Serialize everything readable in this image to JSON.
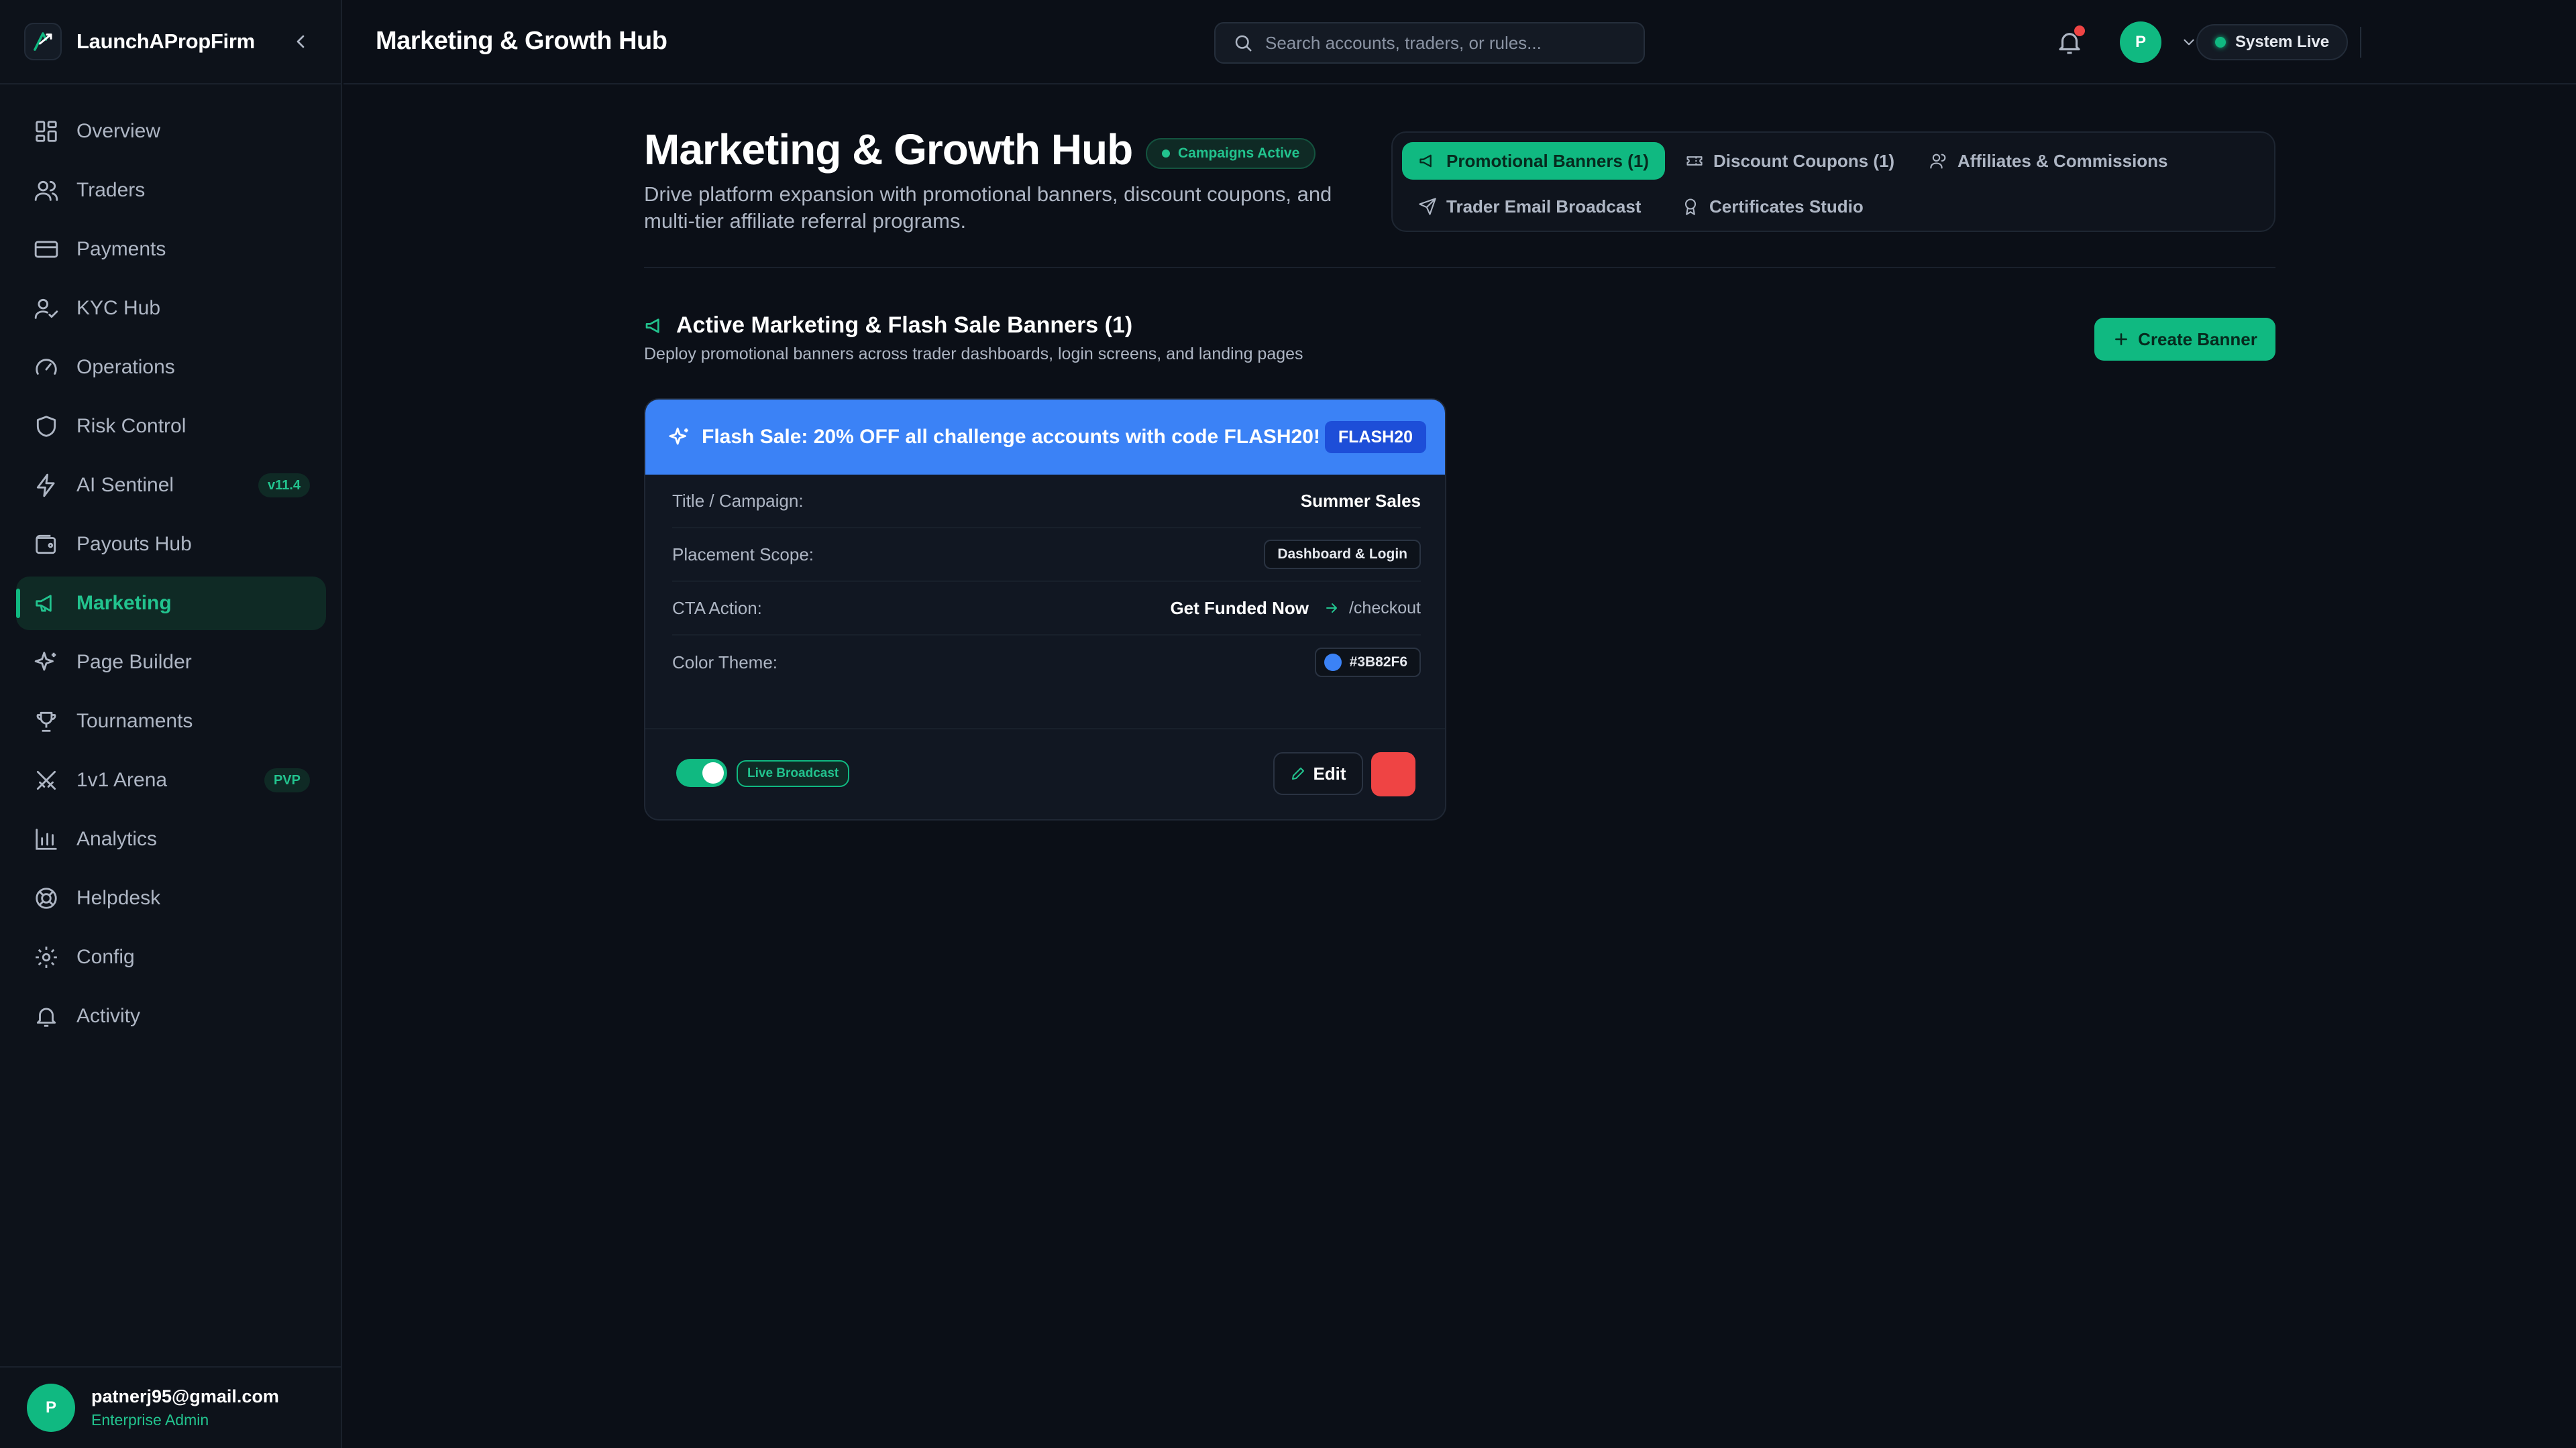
{
  "brand": {
    "name": "LaunchAPropFirm"
  },
  "sidebar": {
    "items": [
      {
        "label": "Overview",
        "icon": "grid-icon"
      },
      {
        "label": "Traders",
        "icon": "users-icon"
      },
      {
        "label": "Payments",
        "icon": "credit-card-icon"
      },
      {
        "label": "KYC Hub",
        "icon": "user-check-icon"
      },
      {
        "label": "Operations",
        "icon": "gauge-icon"
      },
      {
        "label": "Risk Control",
        "icon": "shield-icon"
      },
      {
        "label": "AI Sentinel",
        "icon": "bolt-icon",
        "badge": "v11.4"
      },
      {
        "label": "Payouts Hub",
        "icon": "wallet-icon"
      },
      {
        "label": "Marketing",
        "icon": "megaphone-icon",
        "active": true
      },
      {
        "label": "Page Builder",
        "icon": "sparkles-icon"
      },
      {
        "label": "Tournaments",
        "icon": "trophy-icon"
      },
      {
        "label": "1v1 Arena",
        "icon": "swords-icon",
        "badge": "PVP"
      },
      {
        "label": "Analytics",
        "icon": "bar-chart-icon"
      },
      {
        "label": "Helpdesk",
        "icon": "lifebuoy-icon"
      },
      {
        "label": "Config",
        "icon": "gear-icon"
      },
      {
        "label": "Activity",
        "icon": "bell-icon"
      }
    ]
  },
  "user": {
    "initial": "P",
    "email": "patnerj95@gmail.com",
    "role": "Enterprise Admin"
  },
  "topbar": {
    "title": "Marketing & Growth Hub",
    "search_placeholder": "Search accounts, traders, or rules...",
    "status": "System Live",
    "avatar_initial": "P"
  },
  "header": {
    "title": "Marketing & Growth Hub",
    "status_pill": "Campaigns Active",
    "subtitle": "Drive platform expansion with promotional banners, discount coupons, and multi-tier affiliate referral programs."
  },
  "tabs": [
    {
      "label": "Promotional Banners (1)",
      "icon": "megaphone-icon",
      "active": true
    },
    {
      "label": "Discount Coupons (1)",
      "icon": "ticket-icon"
    },
    {
      "label": "Affiliates & Commissions",
      "icon": "users-icon"
    },
    {
      "label": "Trader Email Broadcast",
      "icon": "send-icon"
    },
    {
      "label": "Certificates Studio",
      "icon": "award-icon"
    }
  ],
  "section": {
    "title": "Active Marketing & Flash Sale Banners (1)",
    "subtitle": "Deploy promotional banners across trader dashboards, login screens, and landing pages",
    "create_label": "Create Banner"
  },
  "banner": {
    "message": "Flash Sale: 20% OFF all challenge accounts with code FLASH20!",
    "code": "FLASH20",
    "color": "#3B82F6",
    "rows": {
      "title_label": "Title / Campaign:",
      "title_value": "Summer Sales",
      "scope_label": "Placement Scope:",
      "scope_value": "Dashboard & Login",
      "cta_label": "CTA Action:",
      "cta_value": "Get Funded Now",
      "cta_path": "/checkout",
      "color_label": "Color Theme:",
      "color_value": "#3B82F6"
    },
    "live_label": "Live Broadcast",
    "live_enabled": true,
    "edit_label": "Edit"
  },
  "colors": {
    "accent": "#10B981",
    "danger": "#EF4444",
    "banner_blue": "#3B82F6"
  }
}
